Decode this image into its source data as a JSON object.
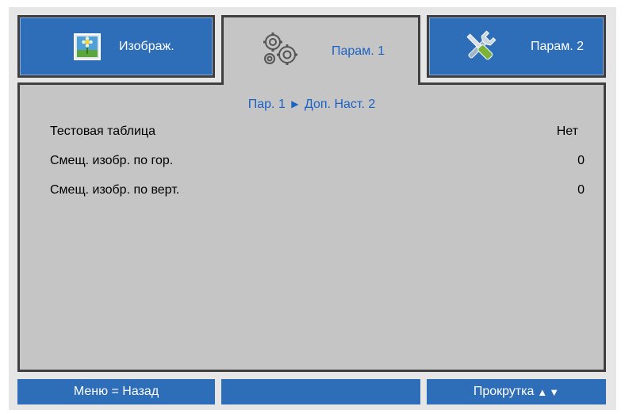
{
  "tabs": [
    {
      "label": "Изображ.",
      "icon": "flower-image-icon"
    },
    {
      "label": "Парам. 1",
      "icon": "gears-icon"
    },
    {
      "label": "Парам. 2",
      "icon": "tools-icon"
    }
  ],
  "breadcrumb": {
    "parent": "Пар. 1",
    "separator": "▶",
    "current": "Доп. Наст. 2"
  },
  "rows": [
    {
      "label": "Тестовая таблица",
      "value": "Нет"
    },
    {
      "label": "Смещ. изобр. по гор.",
      "value": "0"
    },
    {
      "label": "Смещ. изобр. по верт.",
      "value": "0"
    }
  ],
  "footer": {
    "back": "Меню = Назад",
    "middle": "",
    "scroll": "Прокрутка",
    "scroll_up": "▲",
    "scroll_down": "▼"
  },
  "colors": {
    "tab_blue": "#2e6db7",
    "active_text": "#1b62c4",
    "panel_grey": "#c5c5c5",
    "border_dark": "#3f3f3f"
  }
}
